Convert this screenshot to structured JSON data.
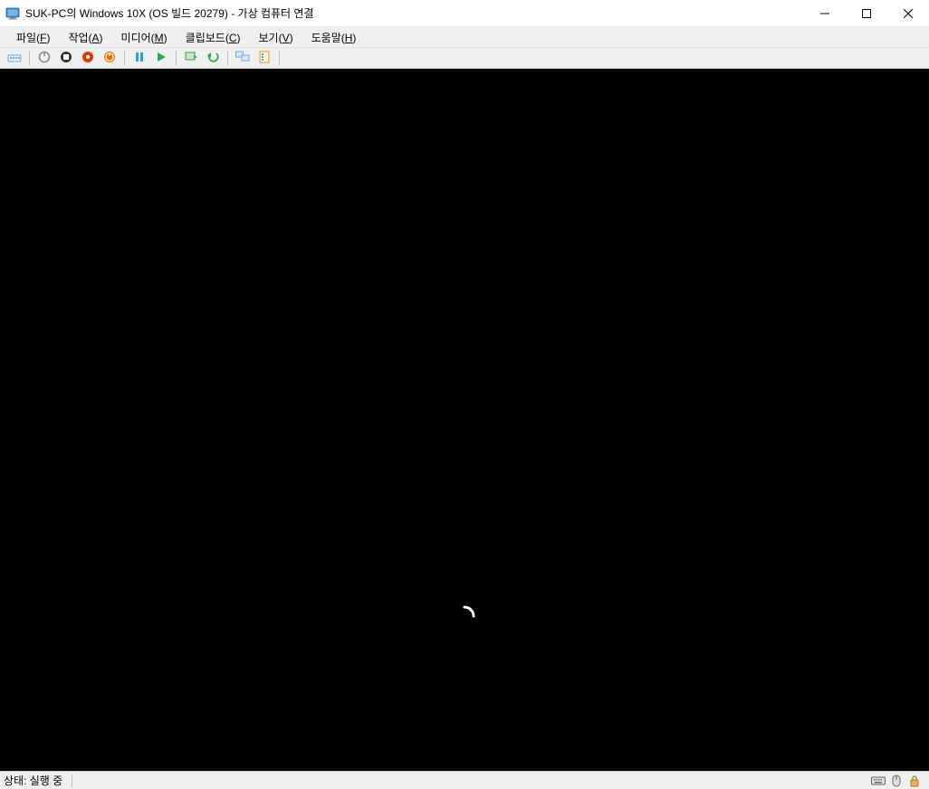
{
  "window": {
    "title": "SUK-PC의 Windows 10X (OS 빌드 20279) - 가상 컴퓨터 연결"
  },
  "menu": {
    "items": [
      {
        "label": "파일",
        "key": "F"
      },
      {
        "label": "작업",
        "key": "A"
      },
      {
        "label": "미디어",
        "key": "M"
      },
      {
        "label": "클립보드",
        "key": "C"
      },
      {
        "label": "보기",
        "key": "V"
      },
      {
        "label": "도움말",
        "key": "H"
      }
    ]
  },
  "toolbar": {
    "groups": [
      [
        "ctrl-alt-del"
      ],
      [
        "turn-off",
        "shut-down",
        "save",
        "power"
      ],
      [
        "pause",
        "start"
      ],
      [
        "checkpoint",
        "revert"
      ],
      [
        "enhanced-session",
        "share"
      ]
    ],
    "icon_names": {
      "ctrl-alt-del": "ctrl-alt-del-icon",
      "turn-off": "turn-off-icon",
      "shut-down": "shut-down-icon",
      "save": "save-state-icon",
      "power": "power-icon",
      "pause": "pause-icon",
      "start": "start-icon",
      "checkpoint": "checkpoint-icon",
      "revert": "revert-icon",
      "enhanced-session": "enhanced-session-icon",
      "share": "share-icon"
    }
  },
  "statusbar": {
    "text": "상태: 실행 중",
    "icons": [
      "keyboard-icon",
      "mouse-icon",
      "lock-icon"
    ]
  }
}
